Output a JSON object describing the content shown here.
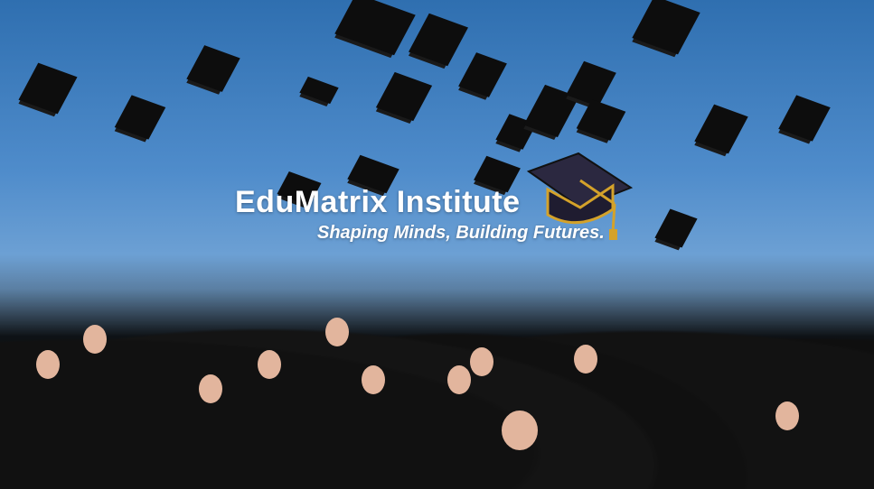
{
  "hero": {
    "title": "EduMatrix Institute",
    "tagline": "Shaping Minds, Building Futures.",
    "background_description_colors": {
      "sky_top": "#2f6fb0",
      "sky_bottom": "#b9d2ea",
      "gowns": "#0c0c0c",
      "cap_accent": "#d4a22a"
    },
    "icons": {
      "logo": "graduation-cap-icon"
    }
  }
}
